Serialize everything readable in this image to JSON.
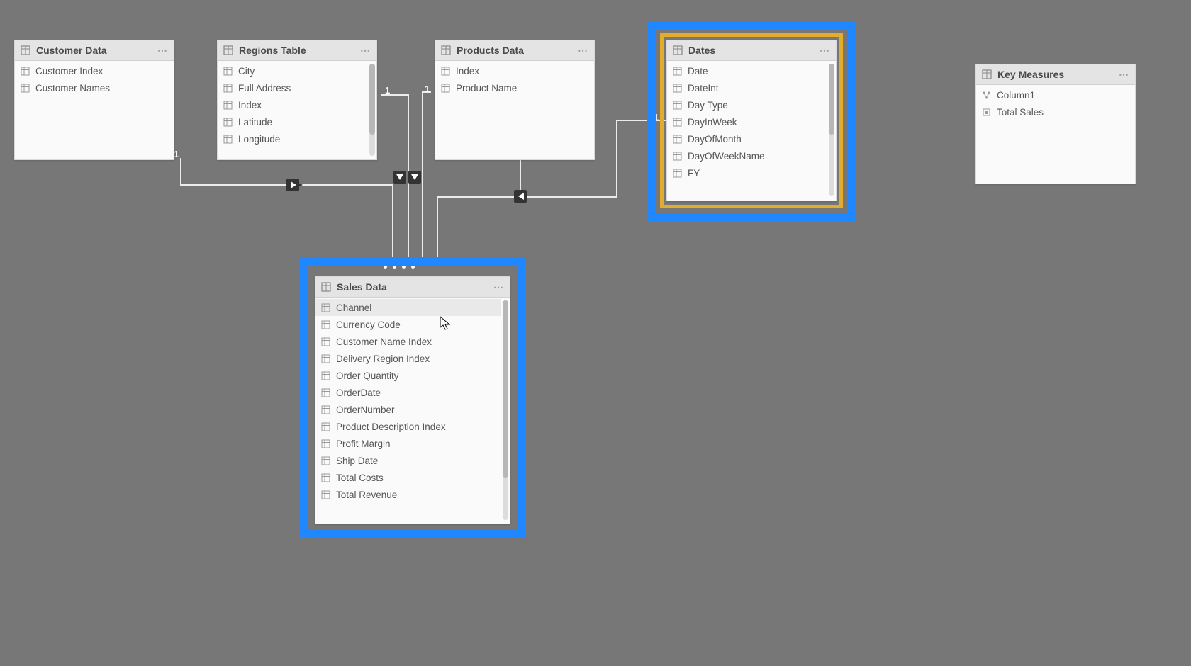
{
  "tables": {
    "customer": {
      "title": "Customer Data",
      "fields": [
        "Customer Index",
        "Customer Names"
      ]
    },
    "regions": {
      "title": "Regions Table",
      "fields": [
        "City",
        "Full Address",
        "Index",
        "Latitude",
        "Longitude"
      ]
    },
    "products": {
      "title": "Products Data",
      "fields": [
        "Index",
        "Product Name"
      ]
    },
    "dates": {
      "title": "Dates",
      "fields": [
        "Date",
        "DateInt",
        "Day Type",
        "DayInWeek",
        "DayOfMonth",
        "DayOfWeekName",
        "FY"
      ]
    },
    "measures": {
      "title": "Key Measures",
      "fields": [
        "Column1",
        "Total Sales"
      ]
    },
    "sales": {
      "title": "Sales Data",
      "fields": [
        "Channel",
        "Currency Code",
        "Customer Name Index",
        "Delivery Region Index",
        "Order Quantity",
        "OrderDate",
        "OrderNumber",
        "Product Description Index",
        "Profit Margin",
        "Ship Date",
        "Total Costs",
        "Total Revenue"
      ]
    }
  },
  "labels": {
    "one": "1"
  },
  "icons": {
    "table": "table-icon",
    "column": "column-icon",
    "hierarchy": "hierarchy-icon",
    "measure": "measure-icon"
  },
  "colors": {
    "background": "#777777",
    "highlight_blue": "#1f87ff",
    "highlight_yellow": "#e2ad2d",
    "card_bg": "#fafafa",
    "header_bg": "#e4e4e4",
    "line": "#ececec"
  }
}
